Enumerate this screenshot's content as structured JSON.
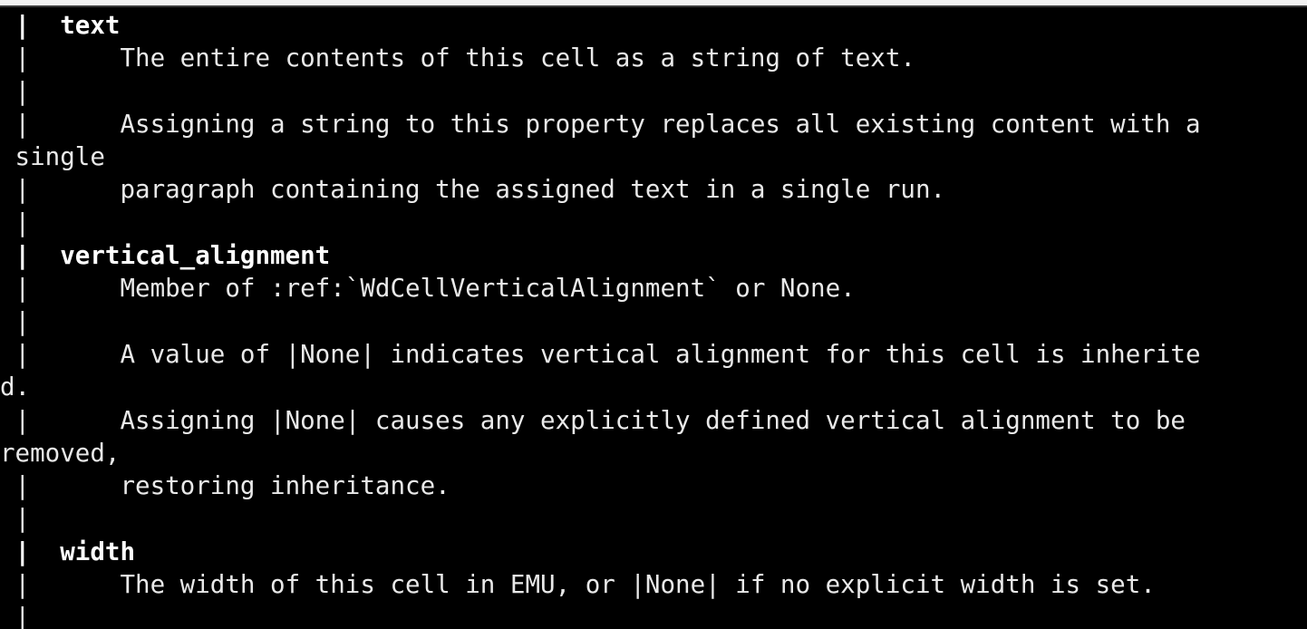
{
  "window": {
    "kind": "terminal-emulator",
    "title": "",
    "background_color": "#000000",
    "foreground_color": "#e9e9e9",
    "chrome_strip_color": "#f2f2f2"
  },
  "terminal": {
    "content_description": "Python help() pager output for a table Cell object, showing data descriptors text, vertical_alignment and width",
    "pager_gutter_char": "|",
    "columns": 86,
    "lines": [
      {
        "text": " |  text",
        "bold": true
      },
      {
        "text": " |      The entire contents of this cell as a string of text.",
        "bold": false
      },
      {
        "text": " |",
        "bold": false
      },
      {
        "text": " |      Assigning a string to this property replaces all existing content with a",
        "bold": false
      },
      {
        "text": " single",
        "bold": false
      },
      {
        "text": " |      paragraph containing the assigned text in a single run.",
        "bold": false
      },
      {
        "text": " |",
        "bold": false
      },
      {
        "text": " |  vertical_alignment",
        "bold": true
      },
      {
        "text": " |      Member of :ref:`WdCellVerticalAlignment` or None.",
        "bold": false
      },
      {
        "text": " |",
        "bold": false
      },
      {
        "text": " |      A value of |None| indicates vertical alignment for this cell is inherite",
        "bold": false
      },
      {
        "text": "d.",
        "bold": false
      },
      {
        "text": " |      Assigning |None| causes any explicitly defined vertical alignment to be",
        "bold": false
      },
      {
        "text": "removed,",
        "bold": false
      },
      {
        "text": " |      restoring inheritance.",
        "bold": false
      },
      {
        "text": " |",
        "bold": false
      },
      {
        "text": " |  width",
        "bold": true
      },
      {
        "text": " |      The width of this cell in EMU, or |None| if no explicit width is set.",
        "bold": false
      },
      {
        "text": " |",
        "bold": false
      }
    ]
  }
}
